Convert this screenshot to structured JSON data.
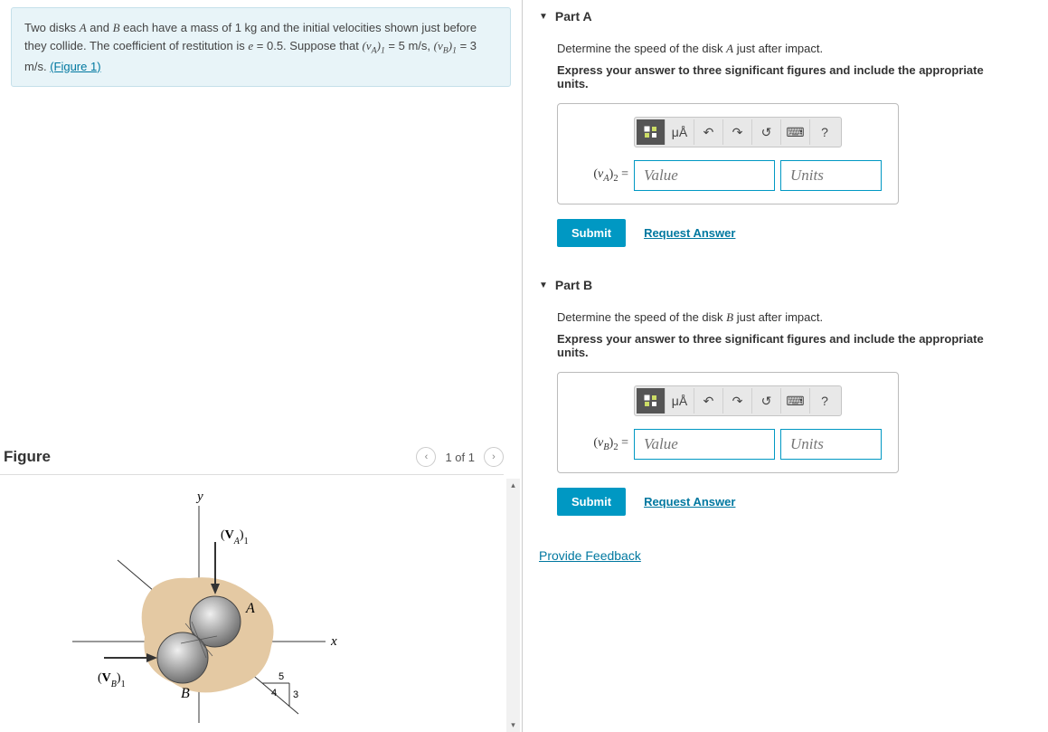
{
  "problem": {
    "text_prefix": "Two disks ",
    "diskA": "A",
    "text_mid1": " and ",
    "diskB": "B",
    "text_mid2": " each have a mass of 1 ",
    "kg": "kg",
    "text_mid3": " and the initial velocities shown just before they collide. The coefficient of restitution is ",
    "e_var": "e",
    "text_mid4": " = 0.5. Suppose that ",
    "vA1": "(v_A)_1",
    "vA1_val": " = 5 m/s",
    "text_mid5": ", ",
    "vB1": "(v_B)_1",
    "vB1_val": " = 3 m/s",
    "text_end": ". ",
    "figure_link": "(Figure 1)"
  },
  "figure": {
    "title": "Figure",
    "page": "1 of 1",
    "labels": {
      "y": "y",
      "x": "x",
      "A": "A",
      "B": "B",
      "vA1": "(V_A)_1",
      "vB1": "(V_B)_1",
      "t3": "3",
      "t4": "4",
      "t5": "5"
    }
  },
  "partA": {
    "header": "Part A",
    "prompt_pre": "Determine the speed of the disk ",
    "prompt_disk": "A",
    "prompt_post": " just after impact.",
    "instruction": "Express your answer to three significant figures and include the appropriate units.",
    "eq_label": "(v_A)_2 =",
    "value_ph": "Value",
    "units_ph": "Units",
    "submit": "Submit",
    "request": "Request Answer",
    "toolbar": {
      "units": "μÅ",
      "help": "?"
    }
  },
  "partB": {
    "header": "Part B",
    "prompt_pre": "Determine the speed of the disk ",
    "prompt_disk": "B",
    "prompt_post": " just after impact.",
    "instruction": "Express your answer to three significant figures and include the appropriate units.",
    "eq_label": "(v_B)_2 =",
    "value_ph": "Value",
    "units_ph": "Units",
    "submit": "Submit",
    "request": "Request Answer",
    "toolbar": {
      "units": "μÅ",
      "help": "?"
    }
  },
  "feedback": "Provide Feedback"
}
